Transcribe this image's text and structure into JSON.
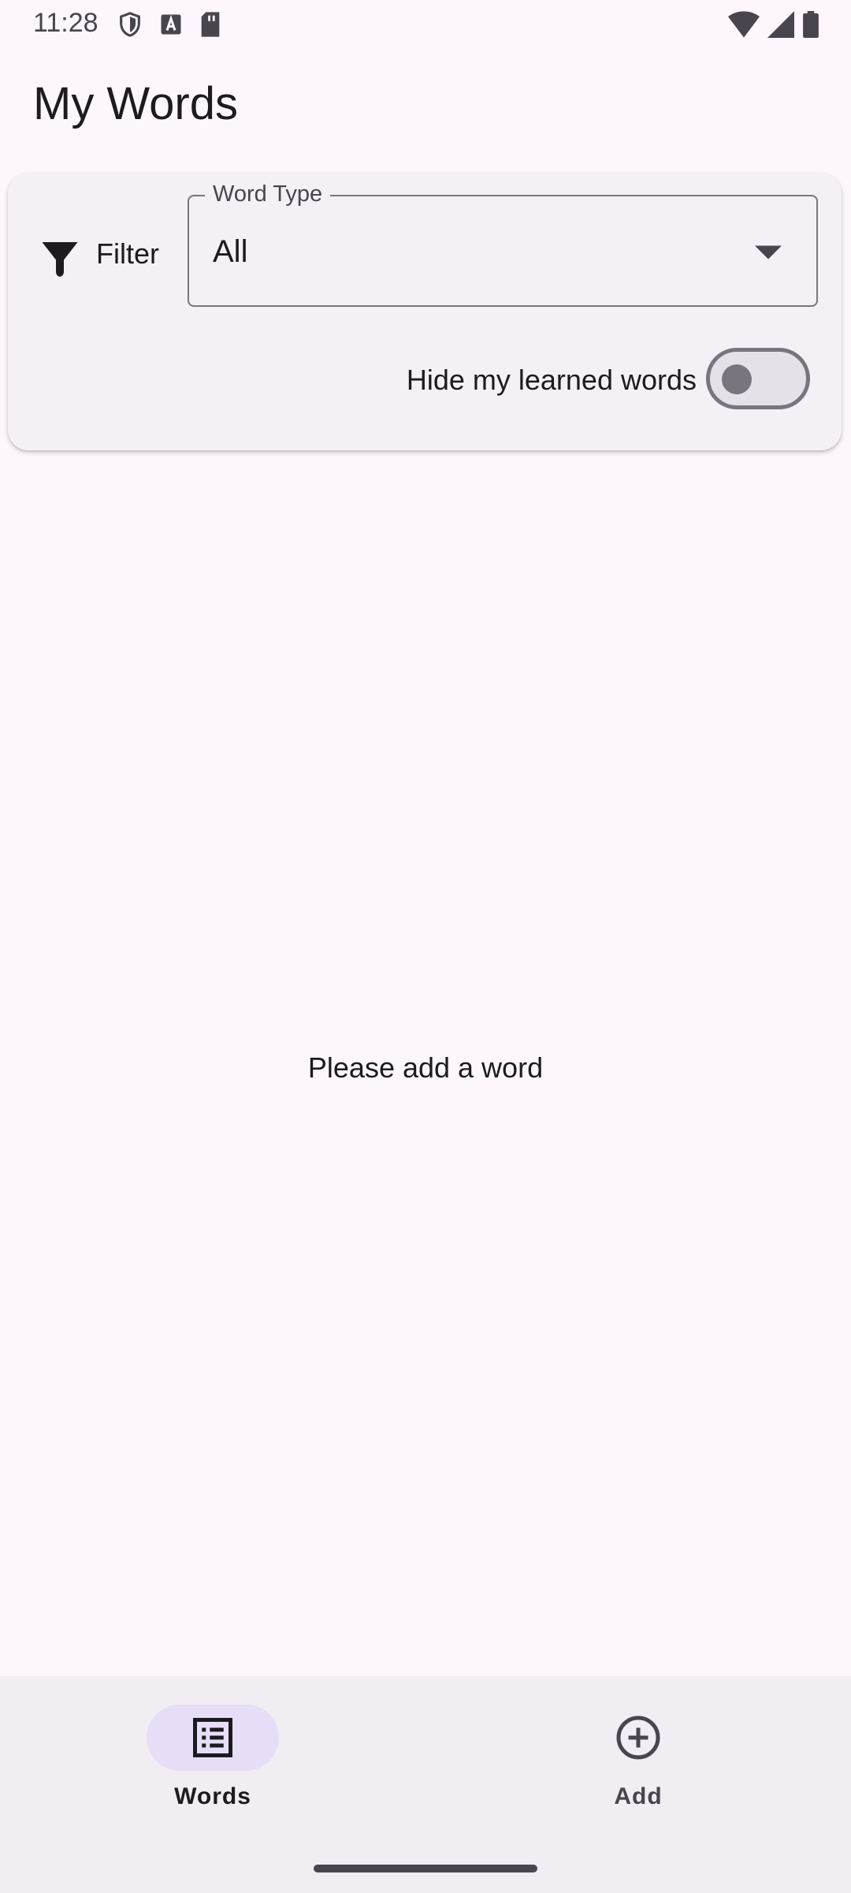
{
  "status_bar": {
    "time": "11:28",
    "left_icons": [
      "shield-icon",
      "text-a-icon",
      "sd-card-icon"
    ],
    "right_icons": [
      "wifi-icon",
      "signal-icon",
      "battery-icon"
    ]
  },
  "page": {
    "title": "My Words"
  },
  "filter": {
    "label": "Filter",
    "icon": "filter-icon",
    "word_type": {
      "label": "Word Type",
      "value": "All"
    },
    "hide_learned": {
      "label": "Hide my learned words",
      "enabled": false
    }
  },
  "empty_state": {
    "message": "Please add a word"
  },
  "bottom_nav": {
    "items": [
      {
        "label": "Words",
        "icon": "list-icon",
        "selected": true
      },
      {
        "label": "Add",
        "icon": "add-circle-icon",
        "selected": false
      }
    ]
  },
  "colors": {
    "background": "#fdf7fd",
    "card": "#f5eff6",
    "nav_background": "#f2ecf3",
    "nav_selected_pill": "#e8ddf6",
    "outline": "#79747e"
  }
}
